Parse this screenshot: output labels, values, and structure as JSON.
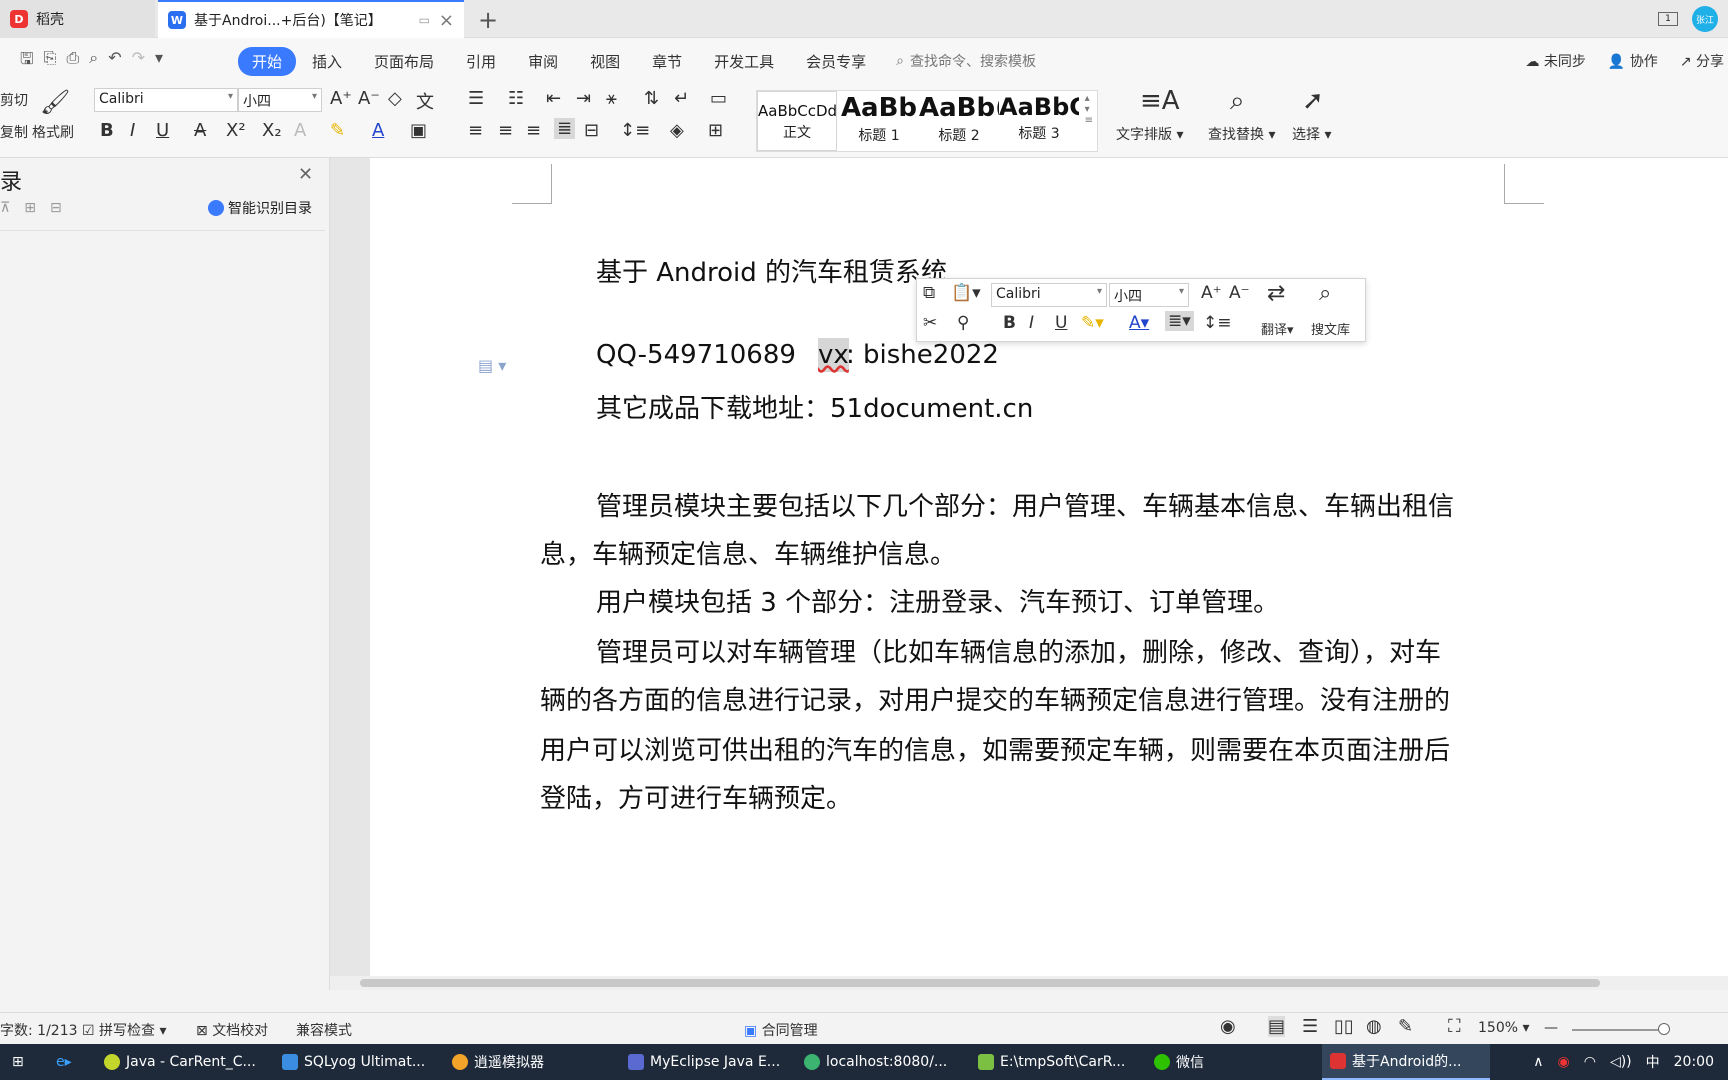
{
  "tabs": {
    "home": "稻壳",
    "doc": "基于Androi...+后台)【笔记】"
  },
  "window": {
    "box_label": "1",
    "avatar": "张江"
  },
  "menu": {
    "items": [
      "开始",
      "插入",
      "页面布局",
      "引用",
      "审阅",
      "视图",
      "章节",
      "开发工具",
      "会员专享"
    ],
    "search_placeholder": "查找命令、搜索模板",
    "right": [
      "未同步",
      "协作",
      "分享"
    ]
  },
  "ribbon": {
    "cut": "剪切",
    "copy": "复制",
    "format_painter": "格式刷",
    "font_name": "Calibri",
    "font_size": "小四",
    "styles": [
      {
        "sample": "AaBbCcDd",
        "label": "正文"
      },
      {
        "sample": "AaBb",
        "label": "标题 1"
      },
      {
        "sample": "AaBb(",
        "label": "标题 2"
      },
      {
        "sample": "AaBbC",
        "label": "标题 3"
      }
    ],
    "text_layout": "文字排版",
    "find_replace": "查找替换",
    "select": "选择"
  },
  "navpane": {
    "title": "录",
    "smart_toc": "智能识别目录"
  },
  "document": {
    "title": "基于 Android 的汽车租赁系统",
    "qq": "QQ-549710689",
    "vx_label": "vx",
    "vx_value": ": bishe2022",
    "download": "其它成品下载地址：51document.cn",
    "para1_line1": "管理员模块主要包括以下几个部分：用户管理、车辆基本信息、车辆出租信",
    "para1_line2": "息，车辆预定信息、车辆维护信息。",
    "para2": "用户模块包括 3 个部分：注册登录、汽车预订、订单管理。",
    "para3_line1": "管理员可以对车辆管理（比如车辆信息的添加，删除，修改、查询），对车",
    "para3_line2": "辆的各方面的信息进行记录，对用户提交的车辆预定信息进行管理。没有注册的",
    "para3_line3": "用户可以浏览可供出租的汽车的信息，如需要预定车辆，则需要在本页面注册后",
    "para3_line4": "登陆，方可进行车辆预定。"
  },
  "mini_toolbar": {
    "font_name": "Calibri",
    "font_size": "小四",
    "translate": "翻译",
    "search_lib": "搜文库"
  },
  "statusbar": {
    "page_count": "字数: 1/213",
    "spell_check": "拼写检查",
    "doc_proof": "文档校对",
    "compat_mode": "兼容模式",
    "contract": "合同管理",
    "zoom": "150%"
  },
  "taskbar": {
    "items": [
      "Java - CarRent_C...",
      "SQLyog Ultimat...",
      "逍遥模拟器",
      "MyEclipse Java E...",
      "localhost:8080/...",
      "E:\\tmpSoft\\CarR...",
      "微信",
      "基于Android的..."
    ],
    "ime": "中",
    "time": "20:00"
  }
}
